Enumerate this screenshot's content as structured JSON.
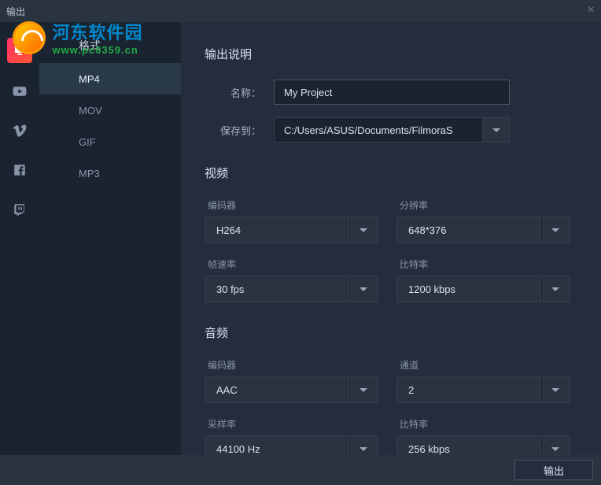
{
  "titlebar": {
    "title": "输出"
  },
  "watermark": {
    "name": "河东软件园",
    "url": "www.pc0359.cn"
  },
  "rail": {
    "items": [
      "local",
      "youtube",
      "vimeo",
      "facebook",
      "twitch"
    ],
    "active": 0
  },
  "formats": {
    "header": "格式",
    "items": [
      "MP4",
      "MOV",
      "GIF",
      "MP3"
    ],
    "active": 0
  },
  "output": {
    "section_title": "输出说明",
    "name_label": "名称：",
    "name_value": "My Project",
    "save_label": "保存到：",
    "save_value": "C:/Users/ASUS/Documents/FilmoraS"
  },
  "video": {
    "section_title": "视频",
    "encoder_label": "编码器",
    "encoder_value": "H264",
    "resolution_label": "分辨率",
    "resolution_value": "648*376",
    "fps_label": "帧速率",
    "fps_value": "30 fps",
    "bitrate_label": "比特率",
    "bitrate_value": "1200 kbps"
  },
  "audio": {
    "section_title": "音频",
    "encoder_label": "编码器",
    "encoder_value": "AAC",
    "channel_label": "通道",
    "channel_value": "2",
    "sample_label": "采样率",
    "sample_value": "44100 Hz",
    "bitrate_label": "比特率",
    "bitrate_value": "256 kbps"
  },
  "footer": {
    "export_label": "输出"
  }
}
